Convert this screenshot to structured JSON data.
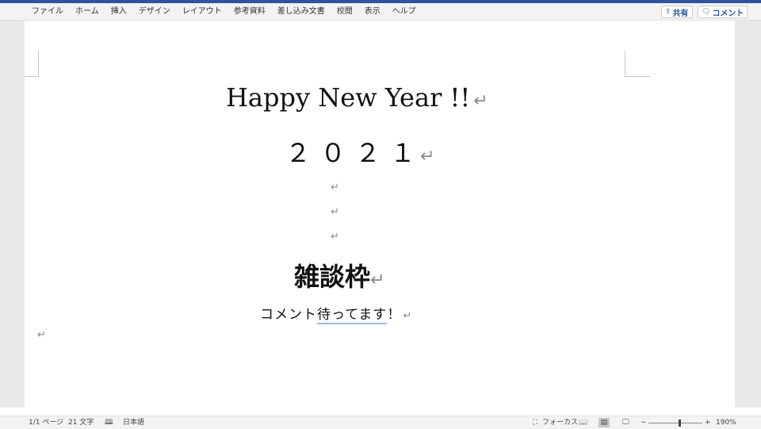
{
  "ribbon": {
    "tabs": [
      "ファイル",
      "ホーム",
      "挿入",
      "デザイン",
      "レイアウト",
      "参考資料",
      "差し込み文書",
      "校閲",
      "表示",
      "ヘルプ"
    ],
    "share_label": "共有",
    "comment_label": "コメント"
  },
  "document": {
    "title": "Happy New Year !!",
    "year": "２０２１",
    "heading": "雑談枠",
    "comment_prefix": "コメント",
    "comment_underlined": "待ってます",
    "comment_suffix": "！",
    "paragraph_mark": "↵"
  },
  "statusbar": {
    "page": "1/1 ページ",
    "words": "21 文字",
    "language": "日本語",
    "focus": "フォーカス",
    "zoom_minus": "−",
    "zoom_plus": "+",
    "zoom_value": "190%",
    "zoom_level_fraction": 0.56
  },
  "colors": {
    "accent": "#2b579a",
    "ribbon_bg": "#f3f3f3",
    "gutter_bg": "#e9e9e9"
  }
}
